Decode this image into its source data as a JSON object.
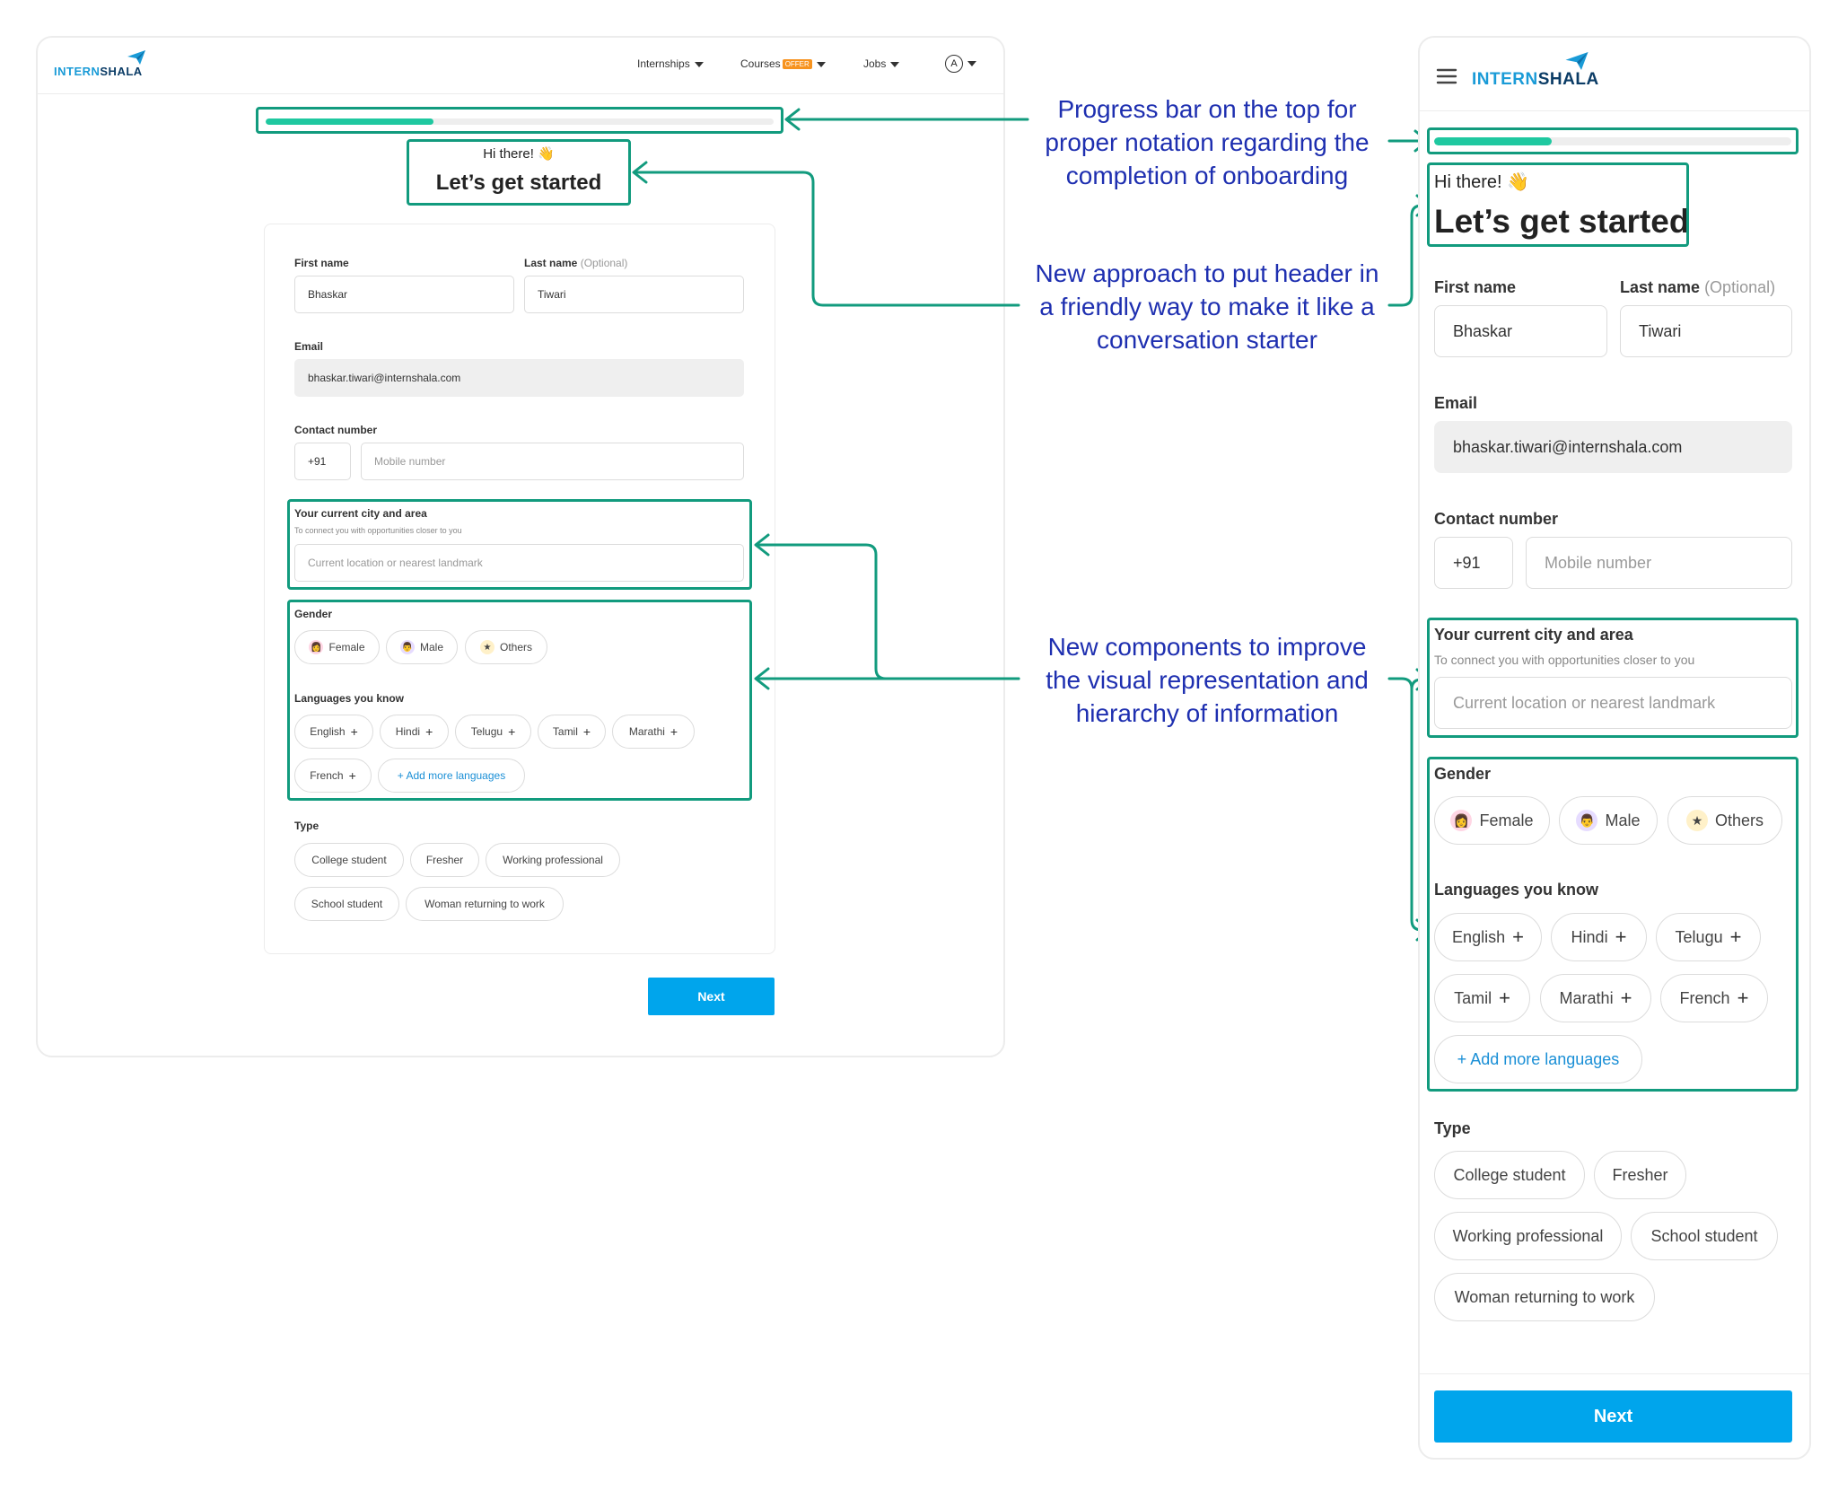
{
  "brand": {
    "name_part1": "INTERN",
    "name_part2": "SHALA"
  },
  "nav": {
    "internships": "Internships",
    "courses": "Courses",
    "offer_badge": "OFFER",
    "jobs": "Jobs",
    "avatar_letter": "A"
  },
  "progress": {
    "fraction": 0.33
  },
  "header": {
    "greeting": "Hi there! 👋",
    "title": "Let’s get started"
  },
  "form": {
    "first_name_label": "First name",
    "first_name_value": "Bhaskar",
    "last_name_label": "Last name",
    "last_name_optional": "(Optional)",
    "last_name_value": "Tiwari",
    "email_label": "Email",
    "email_value": "bhaskar.tiwari@internshala.com",
    "contact_label": "Contact number",
    "country_code": "+91",
    "mobile_placeholder": "Mobile number",
    "city_label": "Your current city and area",
    "city_hint": "To connect you with opportunities closer to you",
    "city_placeholder": "Current location or nearest landmark",
    "gender_label": "Gender",
    "genders": [
      "Female",
      "Male",
      "Others"
    ],
    "languages_label": "Languages you know",
    "languages": [
      "English",
      "Hindi",
      "Telugu",
      "Tamil",
      "Marathi",
      "French"
    ],
    "add_more_languages": "+ Add more languages",
    "type_label": "Type",
    "types": [
      "College student",
      "Fresher",
      "Working professional",
      "School student",
      "Woman returning to work"
    ],
    "next": "Next"
  },
  "annotations": {
    "progress": "Progress bar on the top for proper notation regarding the completion of onboarding",
    "header": "New approach to put header in a friendly way to make it like a conversation starter",
    "components": "New components to improve the visual representation and hierarchy of information"
  },
  "colors": {
    "accent": "#00a5ec",
    "progress": "#1fc8a0",
    "highlight": "#129b7e",
    "annotation": "#1e2fb0",
    "offer": "#f7931e"
  }
}
